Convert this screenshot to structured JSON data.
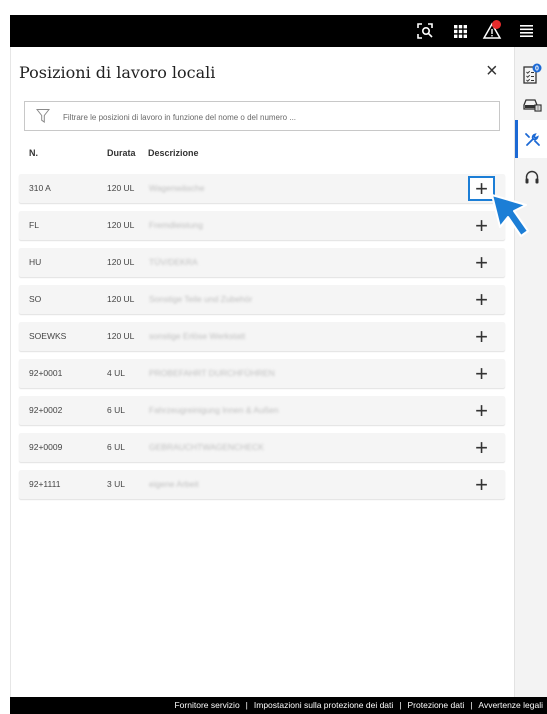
{
  "topbar": {
    "icons": [
      "scan-icon",
      "grid-icon",
      "alert-icon",
      "menu-icon"
    ],
    "notification_color": "#e52b2b"
  },
  "rail": {
    "items": [
      {
        "icon": "checklist-icon",
        "badge": "0"
      },
      {
        "icon": "car-icon"
      },
      {
        "icon": "tools-icon",
        "active": true
      },
      {
        "icon": "headset-icon"
      }
    ]
  },
  "panel": {
    "title": "Posizioni di lavoro locali",
    "close_label": "×"
  },
  "filter": {
    "placeholder": "Filtrare le posizioni di lavoro in funzione del nome o del numero ..."
  },
  "table": {
    "headers": {
      "num": "N.",
      "duration": "Durata",
      "description": "Descrizione"
    },
    "rows": [
      {
        "num": "310 A",
        "duration": "120 UL",
        "description": "Wagenwäsche"
      },
      {
        "num": "FL",
        "duration": "120 UL",
        "description": "Fremdleistung"
      },
      {
        "num": "HU",
        "duration": "120 UL",
        "description": "TÜV/DEKRA"
      },
      {
        "num": "SO",
        "duration": "120 UL",
        "description": "Sonstige Teile und Zubehör"
      },
      {
        "num": "SOEWKS",
        "duration": "120 UL",
        "description": "sonstige Erlöse Werkstatt"
      },
      {
        "num": "92+0001",
        "duration": "4 UL",
        "description": "PROBEFAHRT DURCHFÜHREN"
      },
      {
        "num": "92+0002",
        "duration": "6 UL",
        "description": "Fahrzeugreinigung Innen & Außen"
      },
      {
        "num": "92+0009",
        "duration": "6 UL",
        "description": "GEBRAUCHTWAGENCHECK"
      },
      {
        "num": "92+1111",
        "duration": "3 UL",
        "description": "eigene Arbeit"
      }
    ],
    "add_label": "+"
  },
  "footer": {
    "links": [
      "Fornitore servizio",
      "Impostazioni sulla protezione dei dati",
      "Protezione dati",
      "Avvertenze legali"
    ],
    "separator": "|"
  },
  "colors": {
    "accent": "#1c69d4",
    "highlight": "#1c7ed6"
  }
}
